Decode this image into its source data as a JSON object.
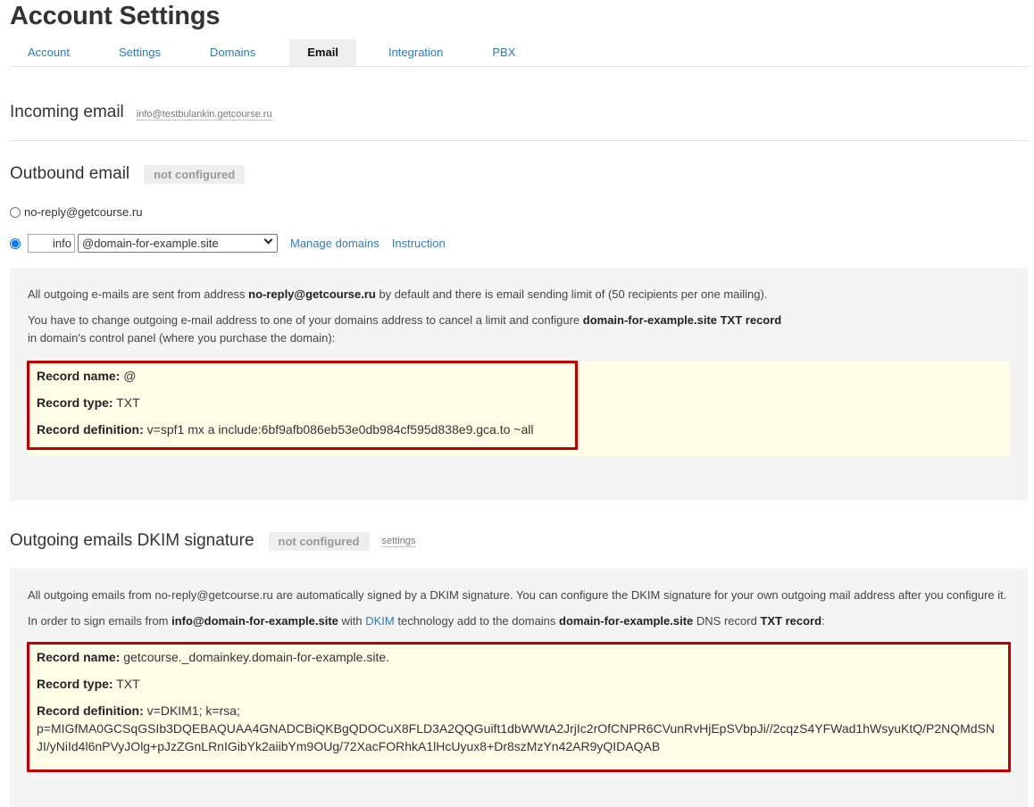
{
  "page_title": "Account Settings",
  "tabs": [
    {
      "label": "Account"
    },
    {
      "label": "Settings"
    },
    {
      "label": "Domains"
    },
    {
      "label": "Email",
      "active": true
    },
    {
      "label": "Integration"
    },
    {
      "label": "PBX"
    }
  ],
  "incoming": {
    "title": "Incoming email",
    "address": "info@testbulankin.getcourse.ru"
  },
  "outbound": {
    "title": "Outbound email",
    "status": "not configured",
    "option_default": "no-reply@getcourse.ru",
    "local_part": "info",
    "domain_selected": "@domain-for-example.site",
    "manage_domains": "Manage domains",
    "instruction": "Instruction",
    "info": {
      "p1_a": "All outgoing e-mails are sent from address ",
      "p1_b": "no-reply@getcourse.ru",
      "p1_c": " by default and there is email sending limit of (50 recipients per one mailing).",
      "p2_a": "You have to change outgoing e-mail address to one of your domains address to cancel a limit   and configure ",
      "p2_b": "domain-for-example.site TXT record",
      "p2_c": "in domain's control panel (where you purchase the domain):"
    },
    "record": {
      "name_label": "Record name:",
      "name_value": " @",
      "type_label": "Record type:",
      "type_value": " TXT",
      "def_label": "Record definition:",
      "def_value": " v=spf1 mx a include:6bf9afb086eb53e0db984cf595d838e9.gca.to ~all"
    }
  },
  "dkim": {
    "title": "Outgoing emails DKIM signature",
    "status": "not configured",
    "settings": "settings",
    "p1": "All outgoing emails from no-reply@getcourse.ru are automatically signed by a DKIM signature. You can configure the DKIM signature for your own outgoing mail address after you configure it.",
    "p2_a": "In order to sign emails from ",
    "p2_b": "info@domain-for-example.site",
    "p2_c": " with ",
    "p2_link": "DKIM",
    "p2_d": " technology add to the domains ",
    "p2_e": "domain-for-example.site",
    "p2_f": " DNS record ",
    "p2_g": "TXT record",
    "p2_h": ":",
    "record": {
      "name_label": "Record name:",
      "name_value": " getcourse._domainkey.domain-for-example.site.",
      "type_label": "Record type:",
      "type_value": " TXT",
      "def_label": "Record definition:",
      "def_value": " v=DKIM1; k=rsa;",
      "def_key": "p=MIGfMA0GCSqGSIb3DQEBAQUAA4GNADCBiQKBgQDOCuX8FLD3A2QQGuift1dbWWtA2JrjIc2rOfCNPR6CVunRvHjEpSVbpJi//2cqzS4YFWad1hWsyuKtQ/P2NQMdSNJI/yNiId4l6nPVyJOlg+pJzZGnLRnIGibYk2aiibYm9OUg/72XacFORhkA1lHcUyux8+Dr8szMzYn42AR9yQIDAQAB"
    }
  }
}
